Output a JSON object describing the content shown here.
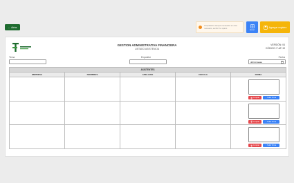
{
  "toolbar": {
    "back_label": "Atrás",
    "notice_text": "Completá los campos necesarios en caso necesario, escribí Tus quiero.",
    "sheet_label": "Excel",
    "save_label": "Agregar registro"
  },
  "header": {
    "title": "GESTION ADMINISTRATIVA FINANCIERA",
    "subtitle": "LISTADO ASISTENCIA",
    "version": "VERSIÓN: 04",
    "code": "CÓDIGO: F-AF-19"
  },
  "fields": {
    "tema_label": "Tema",
    "tema_value": "",
    "expositor_label": "Expositor",
    "expositor_value": "",
    "fecha_label": "Fecha",
    "fecha_value": "dd/mm/aaaa"
  },
  "table": {
    "group_header": "ASISTENTES",
    "columns": [
      "EMPRESA",
      "NOMBRES",
      "APELLIDO",
      "CEDULA",
      "FIRMA"
    ],
    "rows": [
      {
        "empresa": "",
        "nombres": "",
        "apellido": "",
        "cedula": ""
      },
      {
        "empresa": "",
        "nombres": "",
        "apellido": "",
        "cedula": ""
      },
      {
        "empresa": "",
        "nombres": "",
        "apellido": "",
        "cedula": ""
      }
    ],
    "clear_label": "Limpiar",
    "upload_label": "Subir firma"
  },
  "colors": {
    "back_button": "#1e6b2f",
    "notice_icon": "#f28c1b",
    "excel_button": "#3b82f6",
    "save_button": "#f5b50a",
    "clear_button": "#e5484d",
    "upload_button": "#3b82f6"
  },
  "icons": {
    "back": "arrow-left-icon",
    "notice": "alert-icon",
    "excel": "spreadsheet-icon",
    "save": "save-icon",
    "clear": "trash-icon",
    "upload": "upload-icon"
  }
}
